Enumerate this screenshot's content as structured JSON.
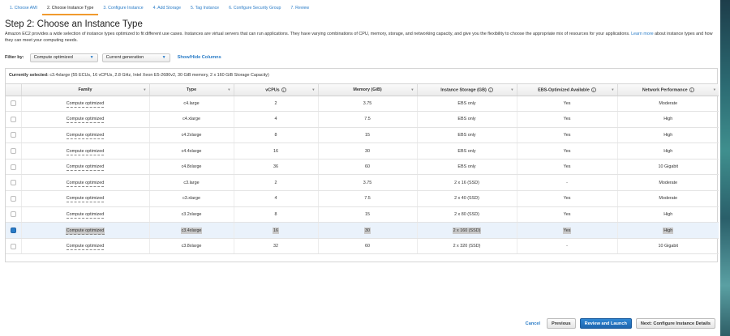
{
  "wizard": {
    "tabs": [
      "1. Choose AMI",
      "2. Choose Instance Type",
      "3. Configure Instance",
      "4. Add Storage",
      "5. Tag Instance",
      "6. Configure Security Group",
      "7. Review"
    ],
    "active_index": 1
  },
  "page": {
    "title": "Step 2: Choose an Instance Type",
    "desc_1": "Amazon EC2 provides a wide selection of instance types optimized to fit different use cases. Instances are virtual servers that can run applications. They have varying combinations of CPU, memory, storage, and networking capacity, and give you the flexibility to choose the appropriate mix of resources for your applications.",
    "desc_link": "Learn more",
    "desc_2": "about instance types and how they can meet your computing needs."
  },
  "filter": {
    "label": "Filter by:",
    "family_value": "Compute optimized",
    "generation_value": "Current generation",
    "show_hide": "Show/Hide Columns"
  },
  "currently_selected": {
    "label": "Currently selected:",
    "value": "c3.4xlarge (55 ECUs, 16 vCPUs, 2.8 GHz, Intel Xeon E5-2680v2, 30 GiB memory, 2 x 160 GiB Storage Capacity)"
  },
  "table": {
    "columns": [
      "Family",
      "Type",
      "vCPUs",
      "Memory (GiB)",
      "Instance Storage (GB)",
      "EBS-Optimized Available",
      "Network Performance"
    ],
    "rows": [
      {
        "family": "Compute optimized",
        "type": "c4.large",
        "vcpus": "2",
        "memory": "3.75",
        "storage": "EBS only",
        "ebs": "Yes",
        "network": "Moderate",
        "selected": false
      },
      {
        "family": "Compute optimized",
        "type": "c4.xlarge",
        "vcpus": "4",
        "memory": "7.5",
        "storage": "EBS only",
        "ebs": "Yes",
        "network": "High",
        "selected": false
      },
      {
        "family": "Compute optimized",
        "type": "c4.2xlarge",
        "vcpus": "8",
        "memory": "15",
        "storage": "EBS only",
        "ebs": "Yes",
        "network": "High",
        "selected": false
      },
      {
        "family": "Compute optimized",
        "type": "c4.4xlarge",
        "vcpus": "16",
        "memory": "30",
        "storage": "EBS only",
        "ebs": "Yes",
        "network": "High",
        "selected": false
      },
      {
        "family": "Compute optimized",
        "type": "c4.8xlarge",
        "vcpus": "36",
        "memory": "60",
        "storage": "EBS only",
        "ebs": "Yes",
        "network": "10 Gigabit",
        "selected": false
      },
      {
        "family": "Compute optimized",
        "type": "c3.large",
        "vcpus": "2",
        "memory": "3.75",
        "storage": "2 x 16 (SSD)",
        "ebs": "-",
        "network": "Moderate",
        "selected": false
      },
      {
        "family": "Compute optimized",
        "type": "c3.xlarge",
        "vcpus": "4",
        "memory": "7.5",
        "storage": "2 x 40 (SSD)",
        "ebs": "Yes",
        "network": "Moderate",
        "selected": false
      },
      {
        "family": "Compute optimized",
        "type": "c3.2xlarge",
        "vcpus": "8",
        "memory": "15",
        "storage": "2 x 80 (SSD)",
        "ebs": "Yes",
        "network": "High",
        "selected": false
      },
      {
        "family": "Compute optimized",
        "type": "c3.4xlarge",
        "vcpus": "16",
        "memory": "30",
        "storage": "2 x 160 (SSD)",
        "ebs": "Yes",
        "network": "High",
        "selected": true
      },
      {
        "family": "Compute optimized",
        "type": "c3.8xlarge",
        "vcpus": "32",
        "memory": "60",
        "storage": "2 x 320 (SSD)",
        "ebs": "-",
        "network": "10 Gigabit",
        "selected": false
      }
    ]
  },
  "footer": {
    "cancel": "Cancel",
    "previous": "Previous",
    "review": "Review and Launch",
    "next": "Next: Configure Instance Details"
  },
  "icons": {
    "info": "info-icon",
    "sort": "sort-icon",
    "dropdown": "chevron-down-icon"
  }
}
